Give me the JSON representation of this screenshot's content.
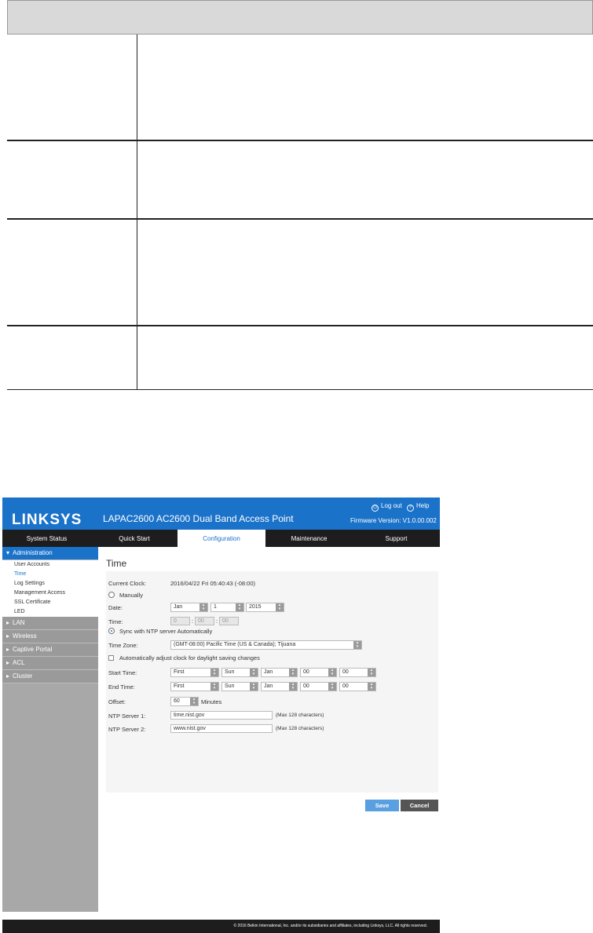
{
  "app": {
    "brand": "LINKSYS",
    "product": "LAPAC2600 AC2600 Dual Band Access Point",
    "logout": "Log out",
    "help": "Help",
    "firmware": "Firmware Version: V1.0.00.002"
  },
  "tabs": [
    "System Status",
    "Quick Start",
    "Configuration",
    "Maintenance",
    "Support"
  ],
  "sidebar": {
    "admin": "Administration",
    "items": [
      "User Accounts",
      "Time",
      "Log Settings",
      "Management Access",
      "SSL Certificate",
      "LED"
    ],
    "sections": [
      "LAN",
      "Wireless",
      "Captive Portal",
      "ACL",
      "Cluster"
    ]
  },
  "time": {
    "title": "Time",
    "current_clock_label": "Current Clock:",
    "current_clock_value": "2016/04/22 Fri 05:40:43 (-08:00)",
    "manually": "Manually",
    "date_label": "Date:",
    "month": "Jan",
    "day": "1",
    "year": "2015",
    "time_label": "Time:",
    "hh": "0",
    "mm": "00",
    "ss": "00",
    "ntp_sync": "Sync with NTP server Automatically",
    "timezone_label": "Time Zone:",
    "timezone_value": "(GMT-08:00) Pacific Time (US & Canada); Tijuana",
    "dst_label": "Automatically adjust clock for daylight saving changes",
    "start_label": "Start Time:",
    "end_label": "End Time:",
    "week": "First",
    "weekday": "Sun",
    "dst_month": "Jan",
    "dst_hour": "00",
    "dst_min": "00",
    "offset_label": "Offset:",
    "offset_value": "60",
    "offset_unit": "Minutes",
    "ntp1_label": "NTP Server 1:",
    "ntp1_value": "time.nist.gov",
    "ntp2_label": "NTP Server 2:",
    "ntp2_value": "www.nist.gov",
    "max_hint": "(Max 128 characters)",
    "save": "Save",
    "cancel": "Cancel"
  },
  "footer": "© 2016 Belkin International, Inc. and/or its subsidiaries and affiliates, including Linksys, LLC. All rights reserved."
}
